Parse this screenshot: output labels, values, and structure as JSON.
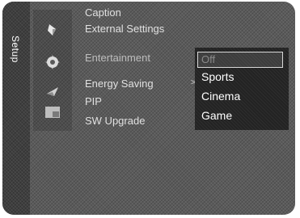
{
  "sidebar": {
    "tab_label": "Setup"
  },
  "icons": [
    "setup-category-icon",
    "setup-gear-icon",
    "energy-icon",
    "picture-in-picture-icon"
  ],
  "menu": {
    "items": [
      {
        "label": "Caption"
      },
      {
        "label": "External Settings"
      },
      {
        "label": "Entertainment"
      },
      {
        "label": "Energy Saving"
      },
      {
        "label": "PIP"
      },
      {
        "label": "SW Upgrade"
      }
    ],
    "arrow": ">"
  },
  "submenu": {
    "options": [
      {
        "label": "Off",
        "selected": true
      },
      {
        "label": "Sports"
      },
      {
        "label": "Cinema"
      },
      {
        "label": "Game"
      }
    ]
  }
}
